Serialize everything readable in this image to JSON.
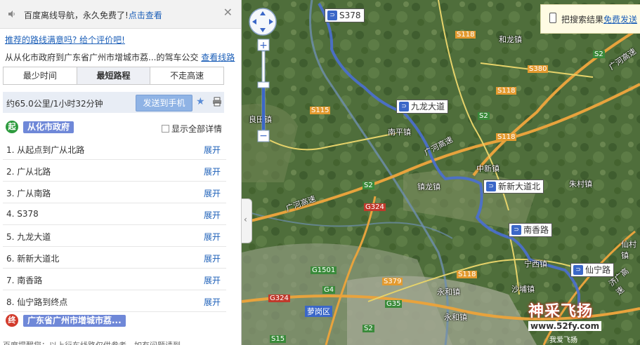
{
  "notice": {
    "text": "百度离线导航，永久免费了!",
    "link": "点击查看"
  },
  "rate_link": "推荐的路线满意吗? 给个评价吧!",
  "route_desc": {
    "text": "从从化市政府到广东省广州市增城市荔...的驾车",
    "bus_prefix": "公交",
    "link": "查看线路"
  },
  "tabs": [
    {
      "label": "最少时间",
      "active": false
    },
    {
      "label": "最短路程",
      "active": true
    },
    {
      "label": "不走高速",
      "active": false
    }
  ],
  "summary": {
    "text": "约65.0公里/1小时32分钟",
    "send_label": "发送到手机"
  },
  "start": {
    "badge": "起",
    "name": "从化市政府",
    "show_all": "显示全部详情"
  },
  "steps": [
    {
      "label": "1. 从起点到广从北路",
      "expand": "展开"
    },
    {
      "label": "2. 广从北路",
      "expand": "展开"
    },
    {
      "label": "3. 广从南路",
      "expand": "展开"
    },
    {
      "label": "4. S378",
      "expand": "展开"
    },
    {
      "label": "5. 九龙大道",
      "expand": "展开"
    },
    {
      "label": "6. 新新大道北",
      "expand": "展开"
    },
    {
      "label": "7. 南香路",
      "expand": "展开"
    },
    {
      "label": "8. 仙宁路到终点",
      "expand": "展开"
    }
  ],
  "end": {
    "badge": "终",
    "name": "广东省广州市增城市荔..."
  },
  "footer_note": "百度提醒您：以上行车线路仅供参考，如有问题请到...",
  "map": {
    "search_tip": {
      "text": "把搜索结果",
      "link": "免费发送"
    },
    "route_markers": [
      {
        "label": "S378"
      },
      {
        "label": "九龙大道"
      },
      {
        "label": "新新大道北"
      },
      {
        "label": "南香路"
      },
      {
        "label": "仙宁路"
      }
    ],
    "road_labels": [
      "S118",
      "S2",
      "S380",
      "S115",
      "S118",
      "S2",
      "S118",
      "S2",
      "G324",
      "G1501",
      "G4",
      "S379",
      "G35",
      "S118",
      "G324",
      "S15",
      "S2"
    ],
    "place_labels": [
      "和龙镇",
      "良田镇",
      "南平镇",
      "中新镇",
      "镇龙镇",
      "朱村镇",
      "宁西镇",
      "沙埔镇",
      "永和镇",
      "永和镇",
      "萝岗区",
      "仙村镇",
      "广河高速",
      "广河高速",
      "广河高速",
      "济广高速"
    ],
    "watermark": {
      "title": "神采飞扬",
      "url": "www.52fy.com",
      "sub": "我爱飞扬"
    },
    "colors": {
      "route": "#4a6fd2",
      "highway": "#e8a33d",
      "water": "#6e8fb0"
    }
  }
}
